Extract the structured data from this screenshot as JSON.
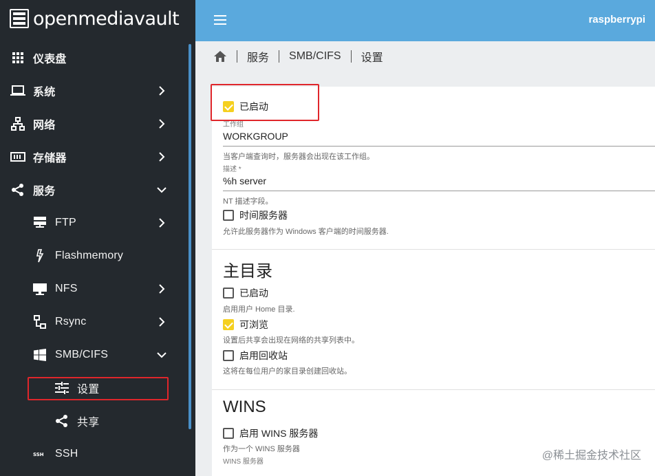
{
  "app": {
    "logo_text": "openmediavault",
    "hostname": "raspberrypi"
  },
  "sidebar": {
    "items": [
      {
        "label": "仪表盘",
        "icon": "dashboard-grid-icon"
      },
      {
        "label": "系统",
        "icon": "laptop-icon"
      },
      {
        "label": "网络",
        "icon": "network-icon"
      },
      {
        "label": "存储器",
        "icon": "storage-icon"
      },
      {
        "label": "服务",
        "icon": "share-icon"
      },
      {
        "label": "FTP",
        "icon": "server-icon"
      },
      {
        "label": "Flashmemory",
        "icon": "flash-icon"
      },
      {
        "label": "NFS",
        "icon": "monitor-icon"
      },
      {
        "label": "Rsync",
        "icon": "sitemap-icon"
      },
      {
        "label": "SMB/CIFS",
        "icon": "windows-icon"
      },
      {
        "label": "设置",
        "icon": "tune-icon"
      },
      {
        "label": "共享",
        "icon": "share-icon"
      },
      {
        "label": "SSH",
        "icon": "ssh-icon"
      }
    ]
  },
  "breadcrumb": {
    "items": [
      "服务",
      "SMB/CIFS",
      "设置"
    ]
  },
  "settings": {
    "enabled": {
      "label": "已启动",
      "checked": true
    },
    "workgroup": {
      "label": "工作组",
      "value": "WORKGROUP",
      "hint": "当客户端查询时，服务器会出现在该工作组。"
    },
    "description": {
      "label": "描述 *",
      "value": "%h server",
      "hint": "NT 描述字段。"
    },
    "time_server": {
      "label": "时间服务器",
      "checked": false,
      "hint": "允许此服务器作为 Windows 客户端的时间服务器."
    }
  },
  "home_section": {
    "title": "主目录",
    "enabled": {
      "label": "已启动",
      "checked": false,
      "hint": "启用用户 Home 目录."
    },
    "browsable": {
      "label": "可浏览",
      "checked": true,
      "hint": "设置后共享会出现在网络的共享列表中。"
    },
    "recycle": {
      "label": "启用回收站",
      "checked": false,
      "hint": "这将在每位用户的家目录创建回收站。"
    }
  },
  "wins_section": {
    "title": "WINS",
    "enable_wins": {
      "label": "启用 WINS 服务器",
      "checked": false,
      "hint": "作为一个 WINS 服务器"
    },
    "wins_server_label": "WINS 服务器"
  },
  "watermark": "@稀土掘金技术社区",
  "colors": {
    "sidebar_bg": "#24292e",
    "topbar_bg": "#5aa9dd",
    "checkbox_checked": "#f5d020",
    "highlight": "#e0262b"
  }
}
